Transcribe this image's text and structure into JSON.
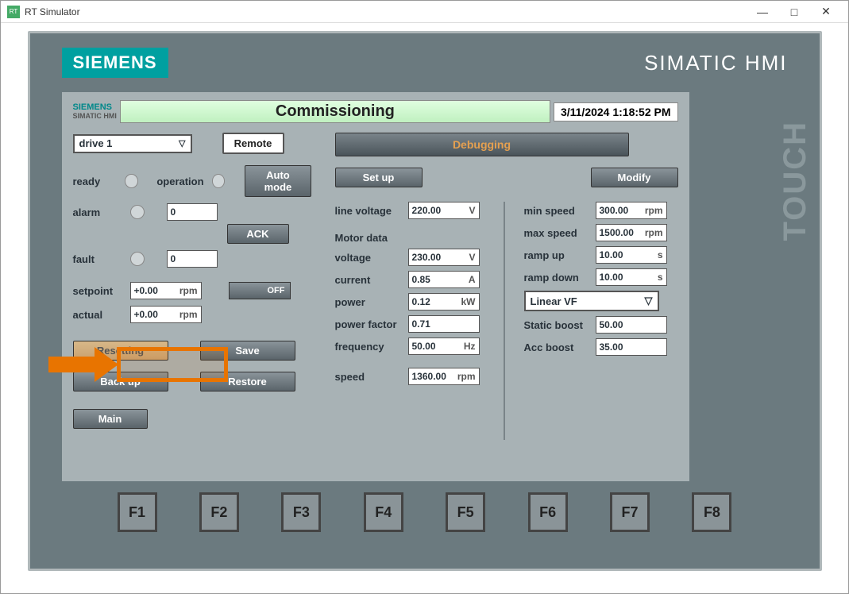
{
  "window": {
    "title": "RT Simulator"
  },
  "brand": {
    "logo": "SIEMENS",
    "product": "SIMATIC HMI",
    "touch": "TOUCH"
  },
  "header": {
    "brand": "SIEMENS",
    "brand_sub": "SIMATIC HMI",
    "title": "Commissioning",
    "datetime": "3/11/2024 1:18:52 PM"
  },
  "left": {
    "drive_select": "drive 1",
    "remote_btn": "Remote",
    "ready_lbl": "ready",
    "operation_lbl": "operation",
    "automode_btn": "Auto mode",
    "alarm_lbl": "alarm",
    "alarm_val": "0",
    "ack_btn": "ACK",
    "fault_lbl": "fault",
    "fault_val": "0",
    "setpoint_lbl": "setpoint",
    "setpoint_val": "+0.00",
    "setpoint_unit": "rpm",
    "off_lbl": "OFF",
    "actual_lbl": "actual",
    "actual_val": "+0.00",
    "actual_unit": "rpm",
    "resetting_btn": "Resetting",
    "save_btn": "Save",
    "backup_btn": "Back up",
    "restore_btn": "Restore",
    "main_btn": "Main"
  },
  "right": {
    "debug_btn": "Debugging",
    "setup_btn": "Set up",
    "modify_btn": "Modify",
    "line_voltage_lbl": "line voltage",
    "line_voltage_val": "220.00",
    "line_voltage_unit": "V",
    "motor_data_lbl": "Motor data",
    "voltage_lbl": "voltage",
    "voltage_val": "230.00",
    "voltage_unit": "V",
    "current_lbl": "current",
    "current_val": "0.85",
    "current_unit": "A",
    "power_lbl": "power",
    "power_val": "0.12",
    "power_unit": "kW",
    "pf_lbl": "power factor",
    "pf_val": "0.71",
    "freq_lbl": "frequency",
    "freq_val": "50.00",
    "freq_unit": "Hz",
    "speed_lbl": "speed",
    "speed_val": "1360.00",
    "speed_unit": "rpm",
    "min_speed_lbl": "min speed",
    "min_speed_val": "300.00",
    "min_speed_unit": "rpm",
    "max_speed_lbl": "max speed",
    "max_speed_val": "1500.00",
    "max_speed_unit": "rpm",
    "ramp_up_lbl": "ramp up",
    "ramp_up_val": "10.00",
    "ramp_up_unit": "s",
    "ramp_down_lbl": "ramp down",
    "ramp_down_val": "10.00",
    "ramp_down_unit": "s",
    "vf_select": "Linear VF",
    "static_boost_lbl": "Static boost",
    "static_boost_val": "50.00",
    "acc_boost_lbl": "Acc boost",
    "acc_boost_val": "35.00"
  },
  "fkeys": [
    "F1",
    "F2",
    "F3",
    "F4",
    "F5",
    "F6",
    "F7",
    "F8"
  ]
}
